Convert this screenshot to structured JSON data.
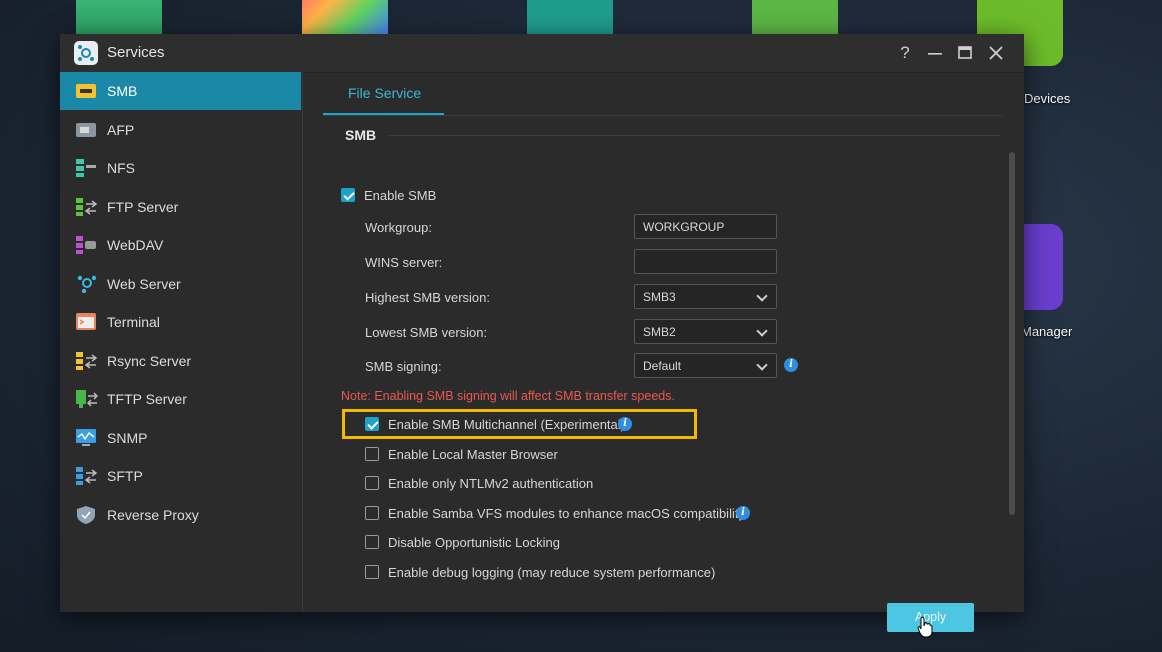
{
  "desktop": {
    "labels": {
      "devices": "Devices",
      "manager": "Manager"
    }
  },
  "window": {
    "title": "Services",
    "controls": [
      "help-icon",
      "minimize-icon",
      "maximize-icon",
      "close-icon"
    ]
  },
  "sidebar": {
    "items": [
      {
        "label": "SMB",
        "icon": "smb-icon",
        "active": true
      },
      {
        "label": "AFP",
        "icon": "afp-icon"
      },
      {
        "label": "NFS",
        "icon": "nfs-icon"
      },
      {
        "label": "FTP Server",
        "icon": "ftp-icon"
      },
      {
        "label": "WebDAV",
        "icon": "webdav-icon"
      },
      {
        "label": "Web Server",
        "icon": "web-server-icon"
      },
      {
        "label": "Terminal",
        "icon": "terminal-icon"
      },
      {
        "label": "Rsync Server",
        "icon": "rsync-icon"
      },
      {
        "label": "TFTP Server",
        "icon": "tftp-icon"
      },
      {
        "label": "SNMP",
        "icon": "snmp-icon"
      },
      {
        "label": "SFTP",
        "icon": "sftp-icon"
      },
      {
        "label": "Reverse Proxy",
        "icon": "shield-icon"
      }
    ]
  },
  "main": {
    "tab": "File Service",
    "section": "SMB",
    "enable_smb": {
      "label": "Enable SMB",
      "checked": true
    },
    "fields": {
      "workgroup": {
        "label": "Workgroup:",
        "value": "WORKGROUP"
      },
      "wins": {
        "label": "WINS server:",
        "value": ""
      },
      "highest": {
        "label": "Highest SMB version:",
        "value": "SMB3"
      },
      "lowest": {
        "label": "Lowest SMB version:",
        "value": "SMB2"
      },
      "signing": {
        "label": "SMB signing:",
        "value": "Default"
      }
    },
    "note": "Note: Enabling SMB signing will affect SMB transfer speeds.",
    "options": {
      "multichannel": {
        "label": "Enable SMB Multichannel (Experimental)",
        "checked": true
      },
      "local_master": {
        "label": "Enable Local Master Browser",
        "checked": false
      },
      "ntlmv2": {
        "label": "Enable only NTLMv2 authentication",
        "checked": false
      },
      "vfs": {
        "label": "Enable Samba VFS modules to enhance macOS compatibility.",
        "checked": false
      },
      "oplocks": {
        "label": "Disable Opportunistic Locking",
        "checked": false
      },
      "debug": {
        "label": "Enable debug logging (may reduce system performance)",
        "checked": false
      }
    },
    "apply": "Apply"
  },
  "colors": {
    "accent": "#1c88a8",
    "highlight": "#f5b800",
    "note": "#e8594f"
  }
}
